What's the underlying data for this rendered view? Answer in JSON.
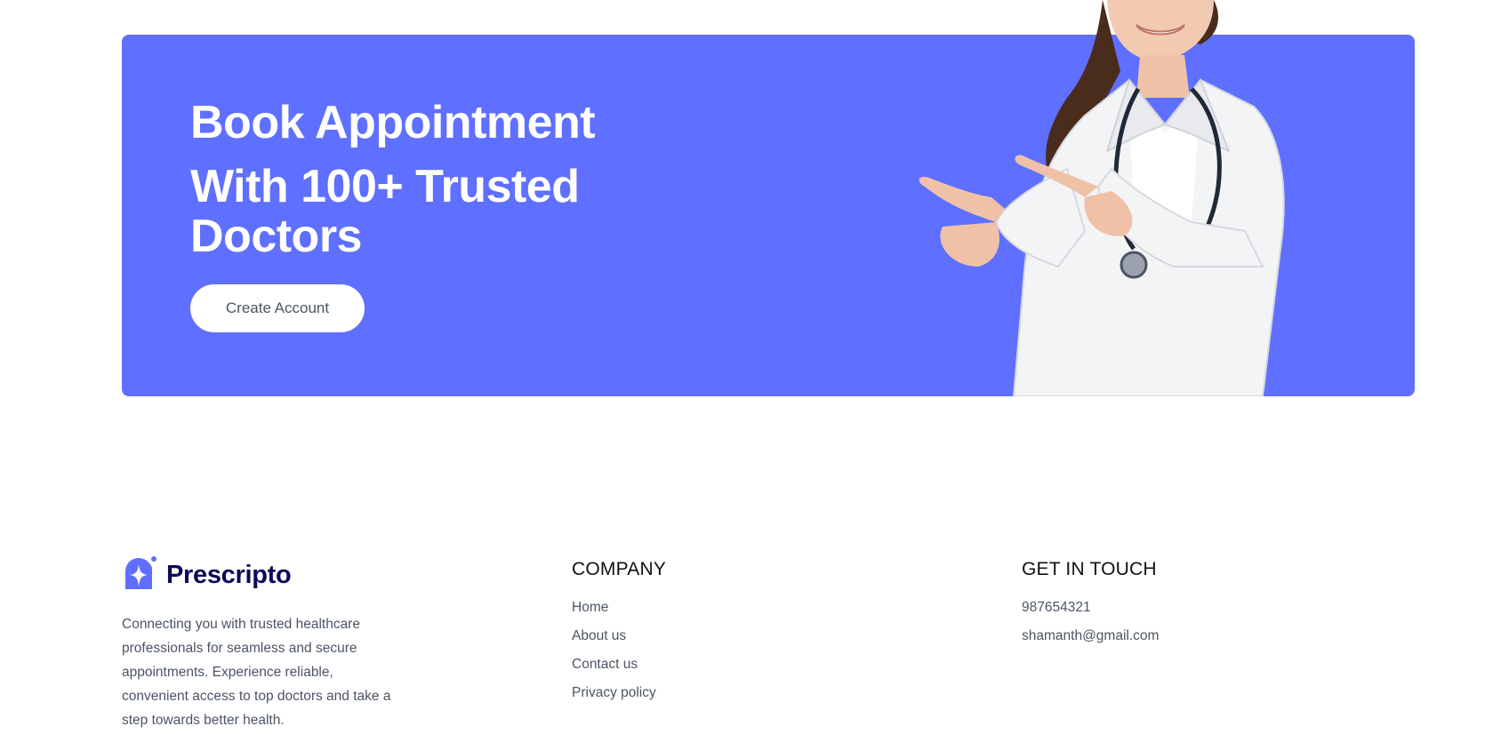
{
  "colors": {
    "banner_bg": "#5f6fff",
    "logo_text": "#0c0a56",
    "heading_text": "#111111",
    "body_text": "#4b5563"
  },
  "banner": {
    "title_line1": "Book Appointment",
    "title_line2": "With 100+ Trusted Doctors",
    "cta_label": "Create Account"
  },
  "footer": {
    "logo_text": "Prescripto",
    "logo_icon": "star-badge-icon",
    "description": "Connecting you with trusted healthcare professionals for seamless and secure appointments. Experience reliable, convenient access to top doctors and take a step towards better health.",
    "company": {
      "title": "COMPANY",
      "links": [
        "Home",
        "About us",
        "Contact us",
        "Privacy policy"
      ]
    },
    "contact": {
      "title": "GET IN TOUCH",
      "phone": "987654321",
      "email": "shamanth@gmail.com"
    }
  }
}
